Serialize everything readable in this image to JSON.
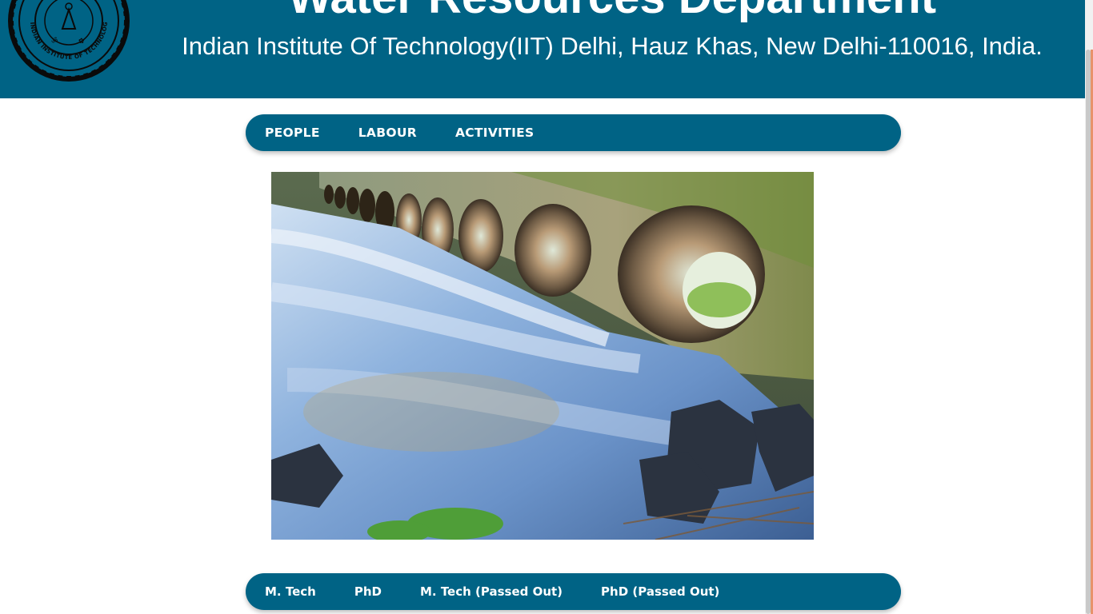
{
  "header": {
    "title": "Water Resources Department",
    "subtitle": "Indian Institute Of Technology(IIT) Delhi, Hauz Khas, New Delhi-110016, India.",
    "logo_text": "INDIAN INSTITUTE OF TECHNOLOGY DELHI",
    "background": "#006385"
  },
  "nav_main": {
    "items": [
      {
        "label": "PEOPLE"
      },
      {
        "label": "LABOUR"
      },
      {
        "label": "ACTIVITIES"
      }
    ]
  },
  "hero": {
    "icon": "culvert-river-photo"
  },
  "nav_programs": {
    "items": [
      {
        "label": "M. Tech"
      },
      {
        "label": "PhD"
      },
      {
        "label": "M. Tech (Passed Out)"
      },
      {
        "label": "PhD (Passed Out)"
      }
    ]
  },
  "colors": {
    "accent": "#006385",
    "text_on_accent": "#ffffff",
    "scroll_accent": "#e8926b"
  }
}
